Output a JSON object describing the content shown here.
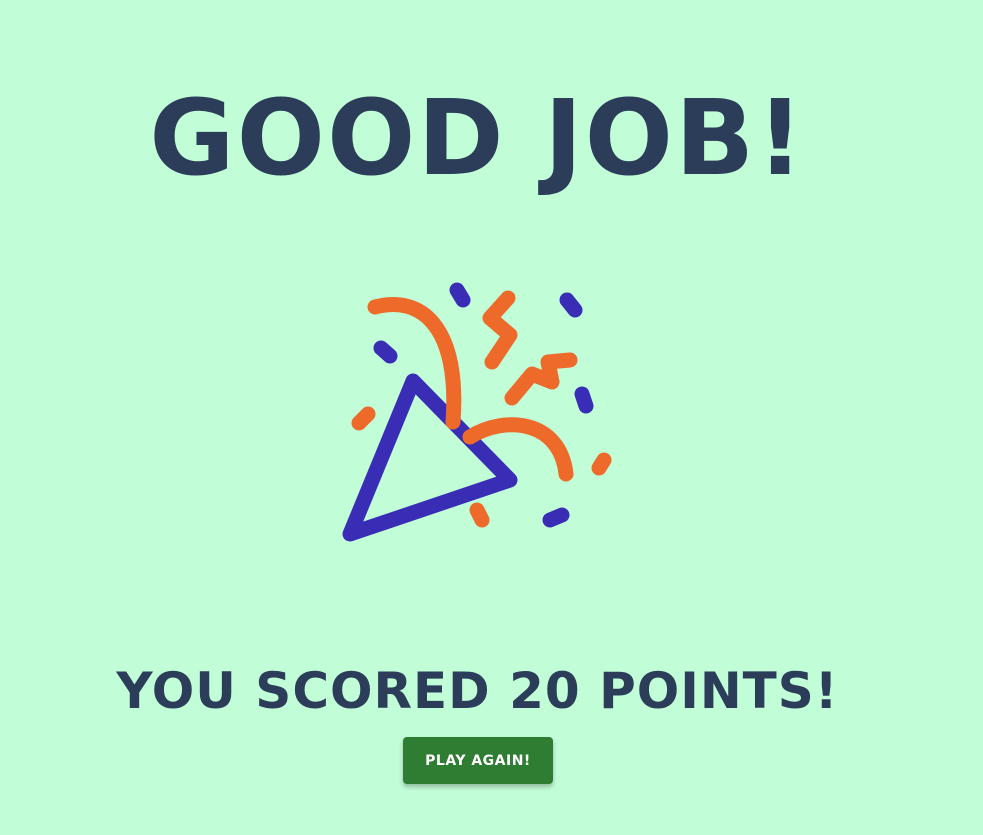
{
  "result": {
    "title": "GOOD JOB!",
    "score_text": "YOU SCORED 20 POINTS!",
    "icon": "party-popper-icon"
  },
  "actions": {
    "play_again_label": "PLAY AGAIN!"
  },
  "colors": {
    "background": "#c1fdd7",
    "text": "#2b3d58",
    "button": "#2e7d32",
    "icon_blue": "#3a2db5",
    "icon_orange": "#ee6a2a"
  }
}
